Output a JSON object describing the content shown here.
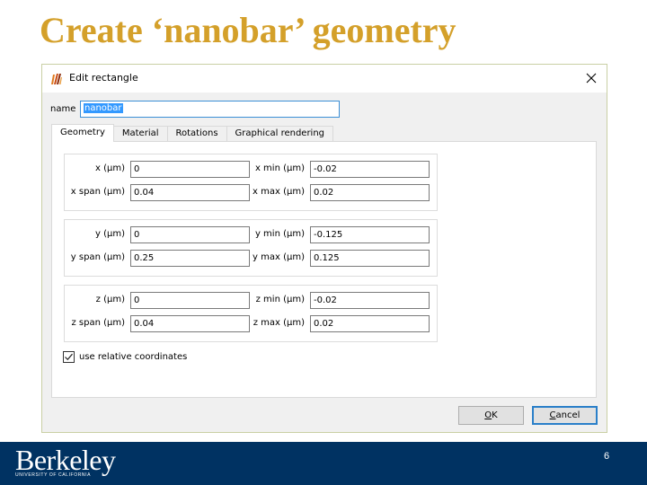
{
  "slide": {
    "title": "Create ‘nanobar’ geometry",
    "title_color": "#d4a02a",
    "page_number": "6"
  },
  "dialog": {
    "title": "Edit rectangle",
    "app_icon": "lumerical-app-icon",
    "close_icon": "close-icon",
    "name_label": "name",
    "name_value": "nanobar",
    "tabs": [
      {
        "label": "Geometry",
        "active": true
      },
      {
        "label": "Material",
        "active": false
      },
      {
        "label": "Rotations",
        "active": false
      },
      {
        "label": "Graphical rendering",
        "active": false
      }
    ],
    "groups": [
      {
        "axis": "x",
        "fields": {
          "center": {
            "label": "x (μm)",
            "value": "0"
          },
          "span": {
            "label": "x span (μm)",
            "value": "0.04"
          },
          "min": {
            "label": "x min (μm)",
            "value": "-0.02"
          },
          "max": {
            "label": "x max (μm)",
            "value": "0.02"
          }
        }
      },
      {
        "axis": "y",
        "fields": {
          "center": {
            "label": "y (μm)",
            "value": "0"
          },
          "span": {
            "label": "y span (μm)",
            "value": "0.25"
          },
          "min": {
            "label": "y min (μm)",
            "value": "-0.125"
          },
          "max": {
            "label": "y max (μm)",
            "value": "0.125"
          }
        }
      },
      {
        "axis": "z",
        "fields": {
          "center": {
            "label": "z (μm)",
            "value": "0"
          },
          "span": {
            "label": "z span (μm)",
            "value": "0.04"
          },
          "min": {
            "label": "z min (μm)",
            "value": "-0.02"
          },
          "max": {
            "label": "z max (μm)",
            "value": "0.02"
          }
        }
      }
    ],
    "relative_coords": {
      "label": "use relative coordinates",
      "checked": true
    },
    "buttons": {
      "ok": {
        "mnemonic": "O",
        "rest": "K"
      },
      "cancel": {
        "mnemonic": "C",
        "rest": "ancel"
      }
    }
  },
  "footer": {
    "logo_word": "Berkeley",
    "logo_sub": "UNIVERSITY OF CALIFORNIA",
    "background": "#003262"
  }
}
